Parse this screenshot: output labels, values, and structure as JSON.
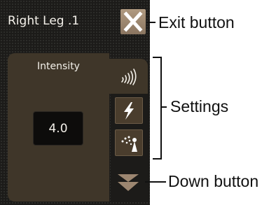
{
  "panel": {
    "title": "Right Leg .1",
    "setting_label": "Intensity",
    "value": "4.0"
  },
  "icons": {
    "exit": "close-icon",
    "waves": "wireless-waves-icon",
    "lightning": "lightning-bolt-icon",
    "spray": "spray-icon",
    "down": "double-chevron-down-icon"
  },
  "callouts": {
    "exit": "Exit button",
    "settings": "Settings",
    "down": "Down button"
  },
  "colors": {
    "background": "#1c1b19",
    "panel": "#3f3629",
    "button": "#4a3d2d",
    "exit_button": "#9c8670"
  }
}
